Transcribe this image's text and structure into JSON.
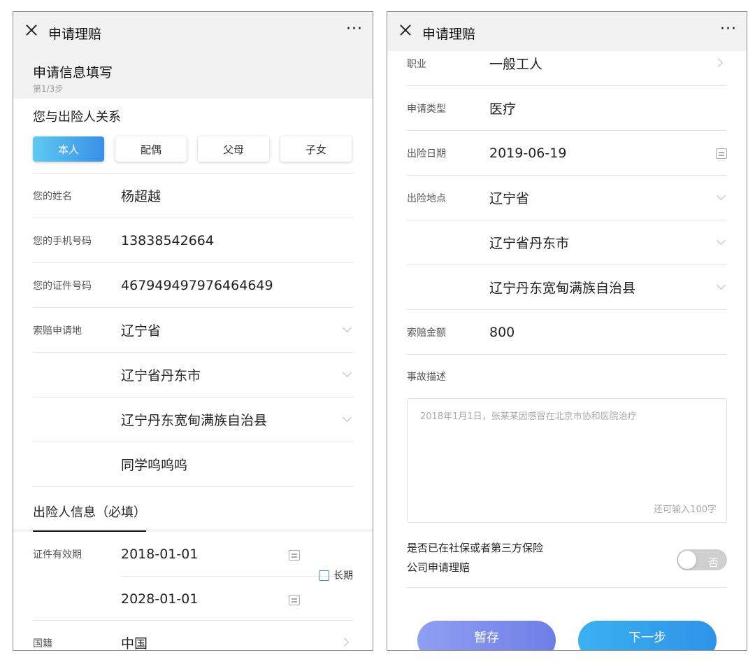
{
  "left": {
    "topbar": {
      "title": "申请理赔",
      "more": "···"
    },
    "step": {
      "title": "申请信息填写",
      "sub": "第1/3步"
    },
    "relation": {
      "label": "您与出险人关系",
      "options": [
        "本人",
        "配偶",
        "父母",
        "子女"
      ],
      "selected": "本人"
    },
    "fields": {
      "name": {
        "label": "您的姓名",
        "value": "杨超越"
      },
      "phone": {
        "label": "您的手机号码",
        "value": "13838542664"
      },
      "id": {
        "label": "您的证件号码",
        "value": "467949497976464649"
      },
      "location": {
        "label": "索赔申请地",
        "province": "辽宁省",
        "city": "辽宁省丹东市",
        "county": "辽宁丹东宽甸满族自治县",
        "address": "同学呜呜呜"
      }
    },
    "insured_tab": "出险人信息（必填）",
    "validity": {
      "label": "证件有效期",
      "start": "2018-01-01",
      "end": "2028-01-01",
      "longterm": "长期"
    },
    "nationality": {
      "label": "国籍",
      "value": "中国"
    }
  },
  "right": {
    "topbar": {
      "title": "申请理赔",
      "more": "···"
    },
    "occupation": {
      "label": "职业",
      "value": "一般工人"
    },
    "apply_type": {
      "label": "申请类型",
      "value": "医疗"
    },
    "date": {
      "label": "出险日期",
      "value": "2019-06-19"
    },
    "place": {
      "label": "出险地点",
      "province": "辽宁省",
      "city": "辽宁省丹东市",
      "county": "辽宁丹东宽甸满族自治县"
    },
    "amount": {
      "label": "索赔金额",
      "value": "800"
    },
    "description": {
      "label": "事故描述",
      "placeholder": "2018年1月1日，张某某因感冒在北京市协和医院治疗",
      "counter": "还可输入100字"
    },
    "third_party": {
      "line1": "是否已在社保或者第三方保险",
      "line2": "公司申请理赔",
      "toggle": "否"
    },
    "buttons": {
      "save": "暂存",
      "next": "下一步"
    }
  }
}
